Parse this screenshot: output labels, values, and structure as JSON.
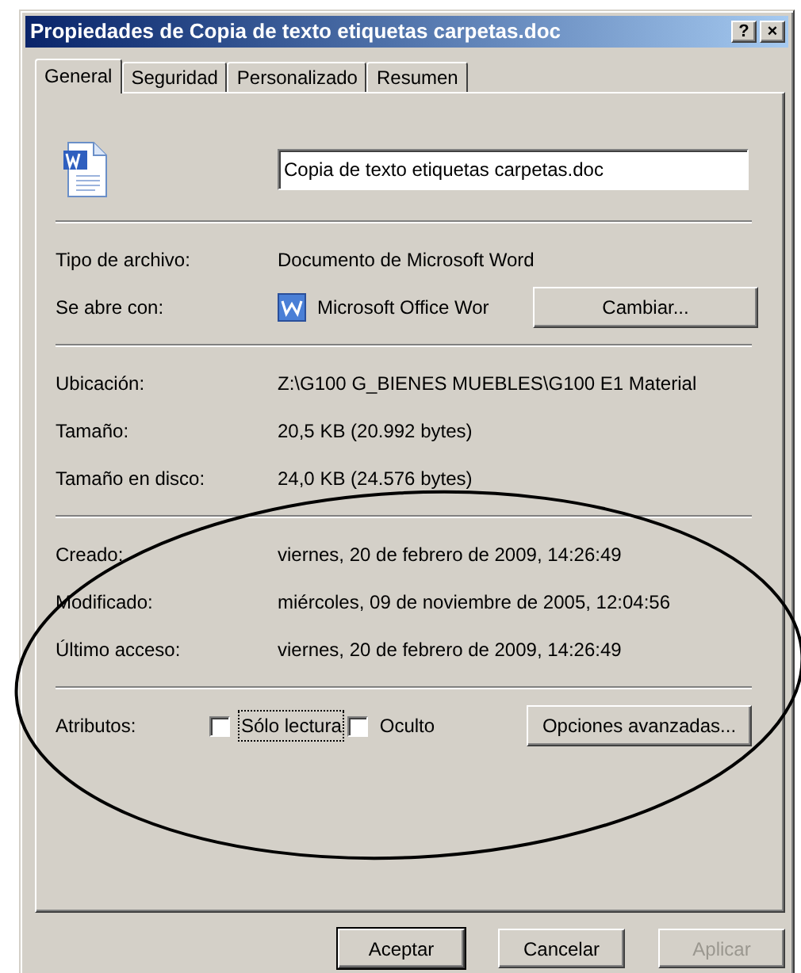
{
  "window": {
    "title": "Propiedades de Copia de texto etiquetas carpetas.doc",
    "title_buttons": [
      "?",
      "×"
    ]
  },
  "tabs": [
    {
      "label": "General",
      "selected": true
    },
    {
      "label": "Seguridad",
      "selected": false
    },
    {
      "label": "Personalizado",
      "selected": false
    },
    {
      "label": "Resumen",
      "selected": false
    }
  ],
  "file_name": {
    "value": "Copia de texto etiquetas carpetas.doc"
  },
  "sections": [
    {
      "rows": [
        {
          "kind": "text",
          "label": "Tipo de archivo:",
          "value": "Documento de Microsoft Word"
        },
        {
          "kind": "app",
          "label": "Se abre con:",
          "value": "Microsoft Office Wor",
          "button": {
            "label": "Cambiar..."
          }
        }
      ]
    },
    {
      "rows": [
        {
          "kind": "text",
          "label": "Ubicación:",
          "value": "Z:\\G100 G_BIENES MUEBLES\\G100 E1 Material"
        },
        {
          "kind": "text",
          "label": "Tamaño:",
          "value": "20,5 KB (20.992 bytes)"
        },
        {
          "kind": "text",
          "label": "Tamaño en disco:",
          "value": "24,0 KB (24.576 bytes)"
        }
      ]
    },
    {
      "rows": [
        {
          "kind": "text",
          "label": "Creado:",
          "value": "viernes, 20 de febrero de 2009, 14:26:49"
        },
        {
          "kind": "text",
          "label": "Modificado:",
          "value": "miércoles, 09 de noviembre de 2005, 12:04:56"
        },
        {
          "kind": "text",
          "label": "Último acceso:",
          "value": "viernes, 20 de febrero de 2009, 14:26:49"
        }
      ]
    },
    {
      "rows": [
        {
          "kind": "attributes",
          "label": "Atributos:",
          "checkboxes": [
            {
              "label": "Sólo lectura",
              "checked": false,
              "focused": true
            },
            {
              "label": "Oculto",
              "checked": false,
              "focused": false
            }
          ],
          "button": {
            "label": "Opciones avanzadas..."
          }
        }
      ]
    }
  ],
  "buttons": [
    {
      "label": "Aceptar",
      "default": true,
      "disabled": false
    },
    {
      "label": "Cancelar",
      "default": false,
      "disabled": false
    },
    {
      "label": "Aplicar",
      "default": false,
      "disabled": true
    }
  ]
}
